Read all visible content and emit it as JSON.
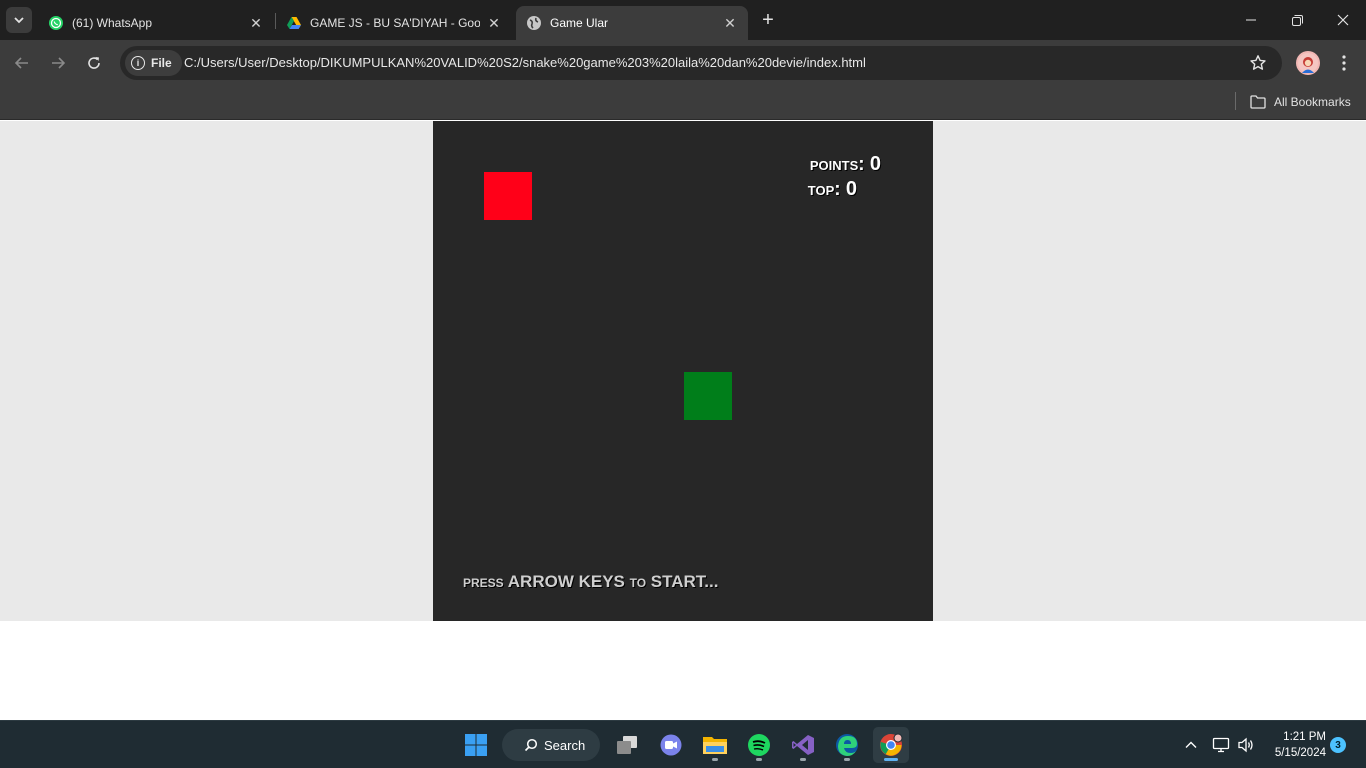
{
  "browser": {
    "tabs": [
      {
        "title": "(61) WhatsApp",
        "icon": "whatsapp-icon",
        "active": false
      },
      {
        "title": "GAME JS - BU SA'DIYAH - Goog",
        "icon": "google-drive-icon",
        "active": false
      },
      {
        "title": "Game Ular",
        "icon": "globe-icon",
        "active": true
      }
    ],
    "new_tab_label": "+",
    "address": {
      "scheme_chip": "File",
      "url": "C:/Users/User/Desktop/DIKUMPULKAN%20VALID%20S2/snake%20game%203%20laila%20dan%20devie/index.html"
    },
    "bookmarks": {
      "all_bookmarks_label": "All Bookmarks"
    }
  },
  "game": {
    "score": {
      "points_label": "points:",
      "points_value": "0",
      "top_label": "top:",
      "top_value": "0"
    },
    "prompt": "press ARROW KEYS to START...",
    "colors": {
      "board": "#272727",
      "food": "#ff0018",
      "snake": "#007e1a",
      "page_background": "#e9e9e9"
    }
  },
  "taskbar": {
    "search_label": "Search",
    "apps": [
      "windows-start-icon",
      "search-icon",
      "task-view-icon",
      "teams-chat-icon",
      "file-explorer-icon",
      "spotify-icon",
      "visual-studio-icon",
      "edge-icon",
      "chrome-icon"
    ],
    "clock": {
      "time": "1:21 PM",
      "date": "5/15/2024"
    },
    "notification_count": "3"
  }
}
